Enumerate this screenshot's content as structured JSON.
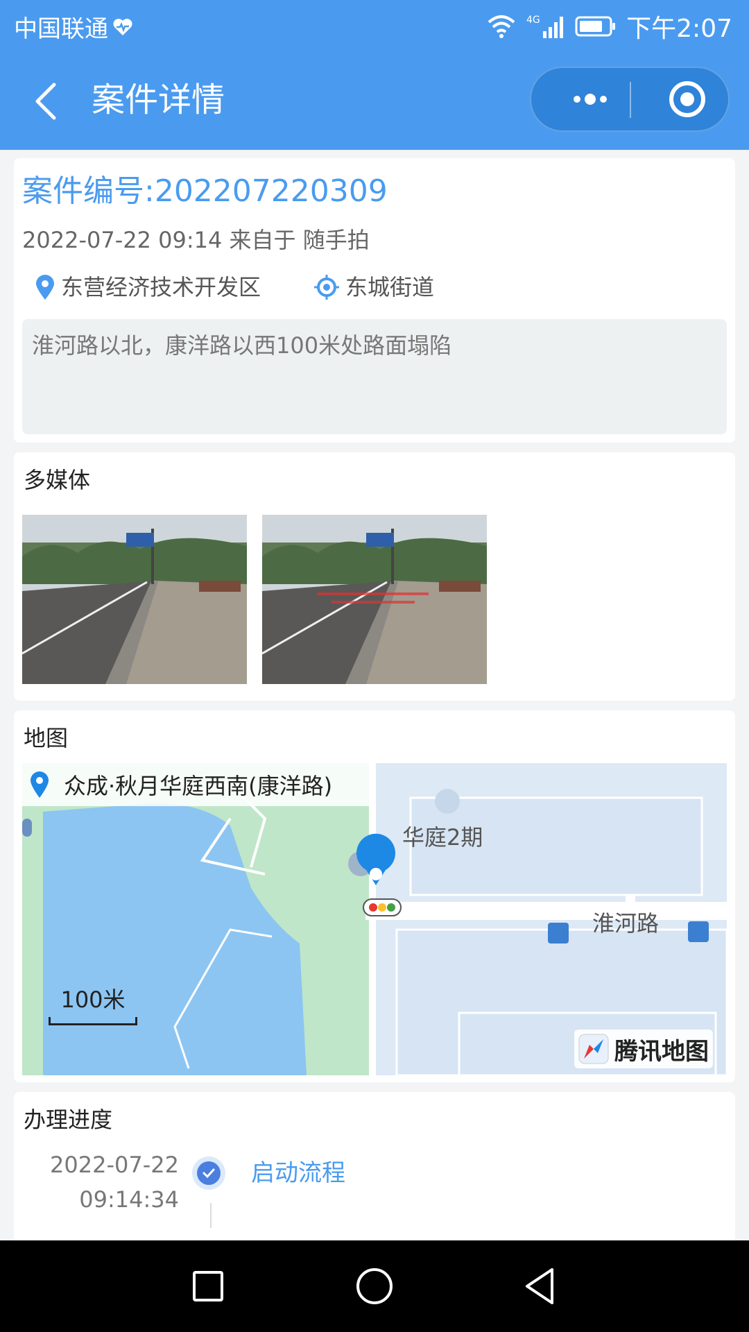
{
  "status_bar": {
    "carrier": "中国联通",
    "time": "下午2:07",
    "network": "4G"
  },
  "nav": {
    "title": "案件详情"
  },
  "case": {
    "number": "案件编号:202207220309",
    "meta": "2022-07-22 09:14 来自于 随手拍",
    "district": "东营经济技术开发区",
    "street": "东城街道",
    "description": "淮河路以北，康洋路以西100米处路面塌陷"
  },
  "media": {
    "title": "多媒体",
    "photos": [
      "road-photo-1",
      "road-photo-2"
    ]
  },
  "map": {
    "title": "地图",
    "location": "众成·秋月华庭西南(康洋路)",
    "label_estate": "华庭2期",
    "label_road": "淮河路",
    "scale": "100米",
    "brand": "腾讯地图"
  },
  "progress": {
    "title": "办理进度",
    "steps": [
      {
        "date": "2022-07-22",
        "time": "09:14:34",
        "label": "启动流程"
      }
    ]
  },
  "colors": {
    "primary": "#4a9bef",
    "nav_capsule": "#2f83d9",
    "description_bg": "#edf1f2",
    "page_bg": "#f2f4f6"
  }
}
